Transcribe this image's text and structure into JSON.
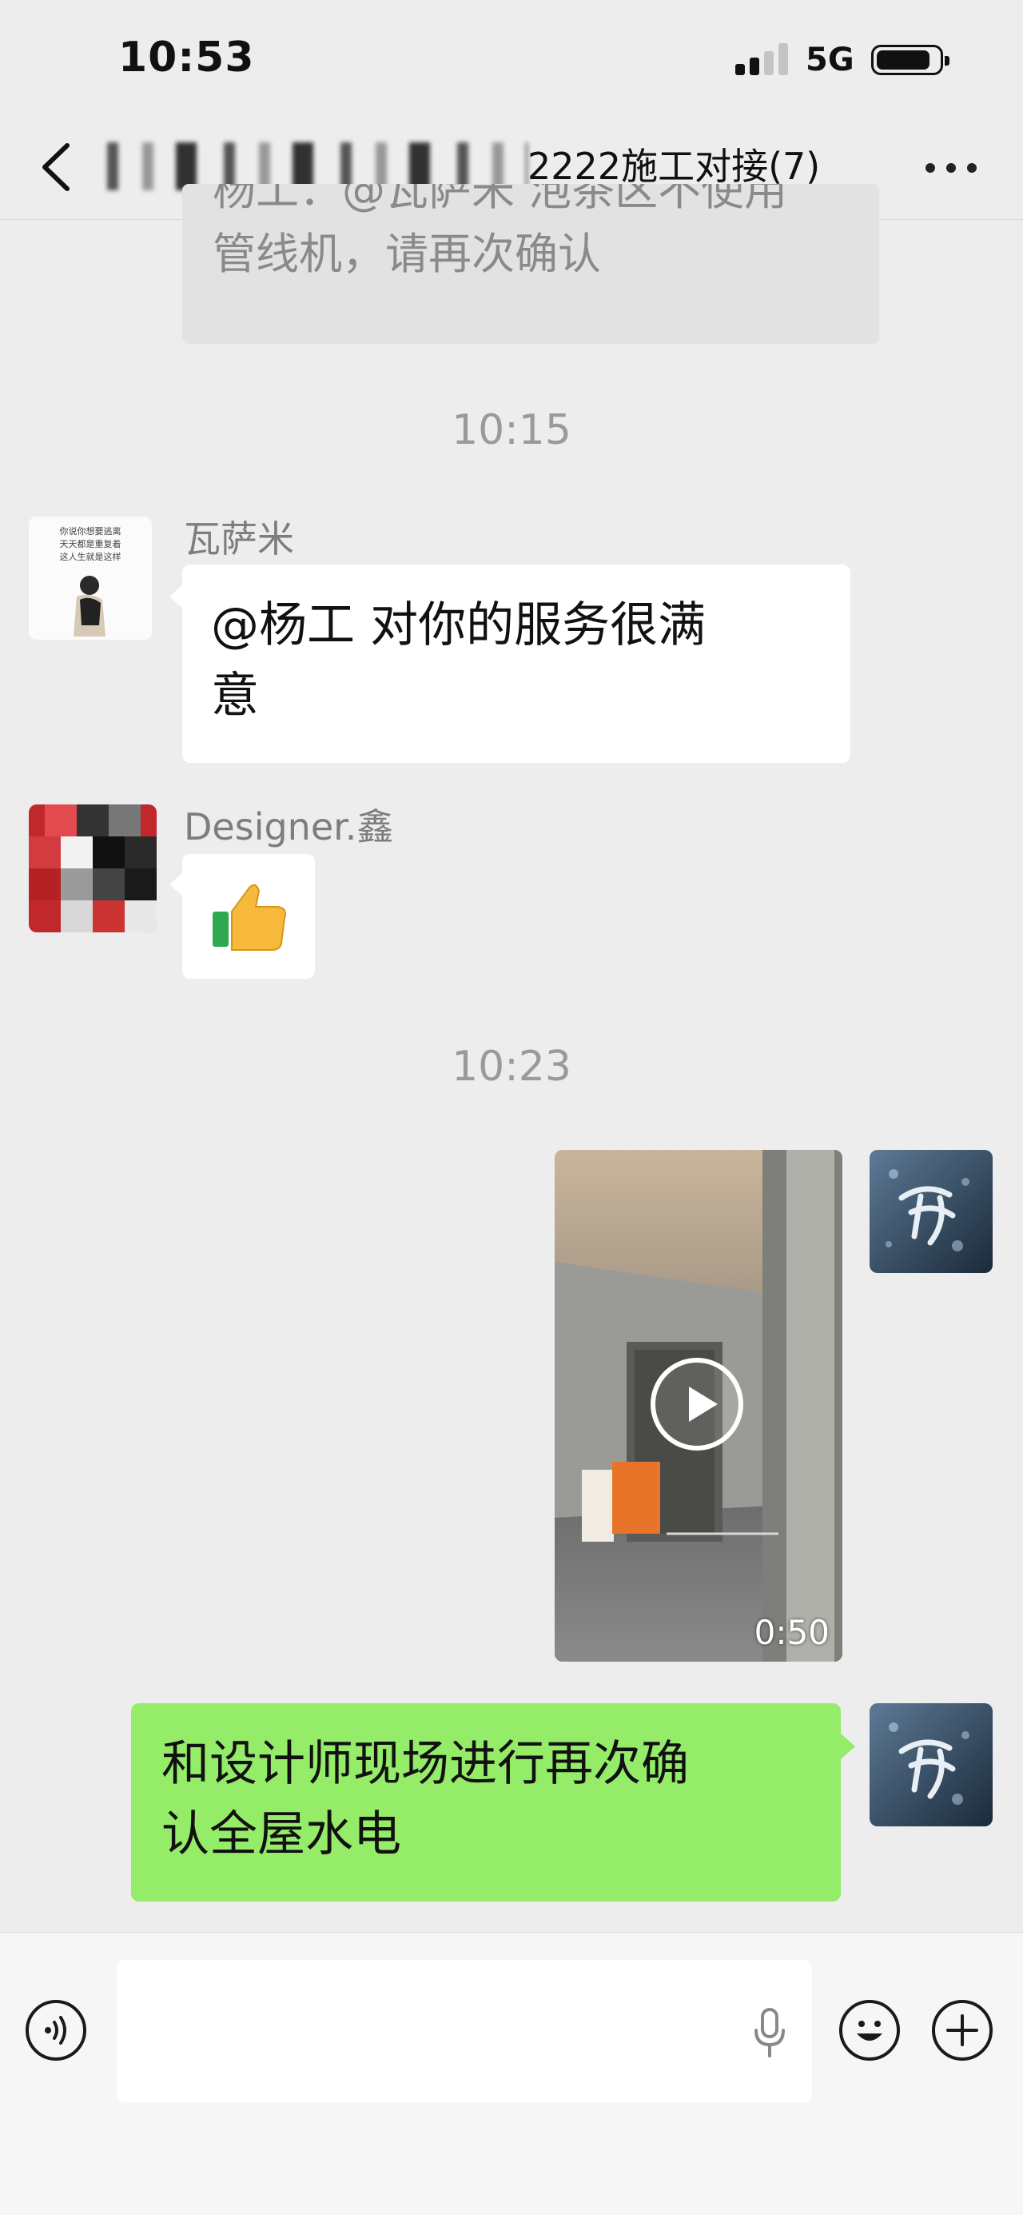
{
  "status_bar": {
    "time": "10:53",
    "network": "5G"
  },
  "nav": {
    "title": "2222施工对接(7)"
  },
  "quoted_message": {
    "line1": "杨工：@瓦萨米 泡茶区不使用",
    "line2": "管线机，请再次确认"
  },
  "messages": [
    {
      "type": "timestamp",
      "text": "10:15"
    },
    {
      "type": "text",
      "sender": "瓦萨米",
      "text_line1": "@杨工 对你的服务很满",
      "text_line2": "意",
      "avatar_caption_1": "你说你想要逃离",
      "avatar_caption_2": "天天都是重复着",
      "avatar_caption_3": "这人生就是这样"
    },
    {
      "type": "emoji",
      "sender": "Designer.鑫",
      "emoji": "👍"
    },
    {
      "type": "timestamp",
      "text": "10:23"
    },
    {
      "type": "video",
      "duration": "0:50"
    },
    {
      "type": "text",
      "text_line1": "和设计师现场进行再次确",
      "text_line2": "认全屋水电"
    }
  ],
  "colors": {
    "background": "#ededed",
    "bubble_self": "#95ec69",
    "bubble_other": "#ffffff",
    "text": "#111111",
    "meta": "#9a9a9a"
  },
  "icons": [
    "back-chevron-icon",
    "more-dots-icon",
    "voice-toggle-icon",
    "microphone-icon",
    "emoji-face-icon",
    "plus-icon",
    "play-icon"
  ]
}
